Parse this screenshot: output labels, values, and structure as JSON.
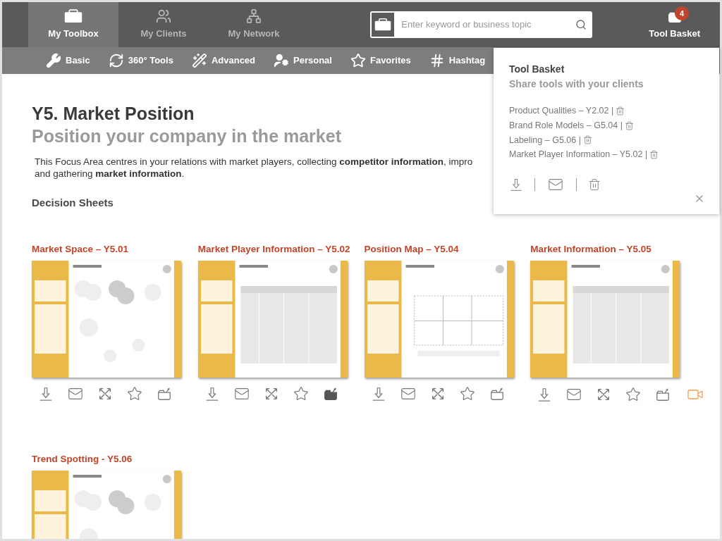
{
  "nav": {
    "tabs": [
      {
        "label": "My Toolbox",
        "selected": true
      },
      {
        "label": "My Clients",
        "selected": false
      },
      {
        "label": "My Network",
        "selected": false
      }
    ],
    "search": {
      "placeholder": "Enter keyword or business topic"
    },
    "basket": {
      "label": "Tool Basket",
      "count": "4"
    }
  },
  "subnav": [
    {
      "label": "Basic"
    },
    {
      "label": "360° Tools"
    },
    {
      "label": "Advanced"
    },
    {
      "label": "Personal"
    },
    {
      "label": "Favorites"
    },
    {
      "label": "Hashtag"
    }
  ],
  "page": {
    "title": "Y5. Market Position",
    "subtitle": "Position your company in the market",
    "description": [
      "This Focus Area centres in your relations with market players, collecting **competitor information**, impro",
      "and gathering **market information**."
    ],
    "section": "Decision Sheets",
    "cards": [
      {
        "title": "Market Space – Y5.01",
        "actions": [
          {
            "kind": "download"
          },
          {
            "kind": "email"
          },
          {
            "kind": "expand"
          },
          {
            "kind": "favorite"
          },
          {
            "kind": "toolbox",
            "in_basket": false
          }
        ]
      },
      {
        "title": "Market Player Information – Y5.02",
        "actions": [
          {
            "kind": "download"
          },
          {
            "kind": "email"
          },
          {
            "kind": "expand"
          },
          {
            "kind": "favorite"
          },
          {
            "kind": "toolbox",
            "in_basket": true
          }
        ]
      },
      {
        "title": "Position Map – Y5.04",
        "actions": [
          {
            "kind": "download"
          },
          {
            "kind": "email"
          },
          {
            "kind": "expand"
          },
          {
            "kind": "favorite"
          },
          {
            "kind": "toolbox",
            "in_basket": false
          }
        ]
      },
      {
        "title": "Market Information – Y5.05",
        "actions": [
          {
            "kind": "download"
          },
          {
            "kind": "email"
          },
          {
            "kind": "expand"
          },
          {
            "kind": "favorite"
          },
          {
            "kind": "toolbox",
            "in_basket": false
          },
          {
            "kind": "video"
          }
        ]
      },
      {
        "title": "Trend Spotting - Y5.06"
      }
    ]
  },
  "popover": {
    "title": "Tool Basket",
    "subtitle": "Share tools with your clients",
    "items": [
      "Product Qualities – Y2.02 |",
      "Brand Role Models – G5.04 |",
      "Labeling – G5.06 |",
      "Market Player Information – Y5.02 |"
    ]
  }
}
